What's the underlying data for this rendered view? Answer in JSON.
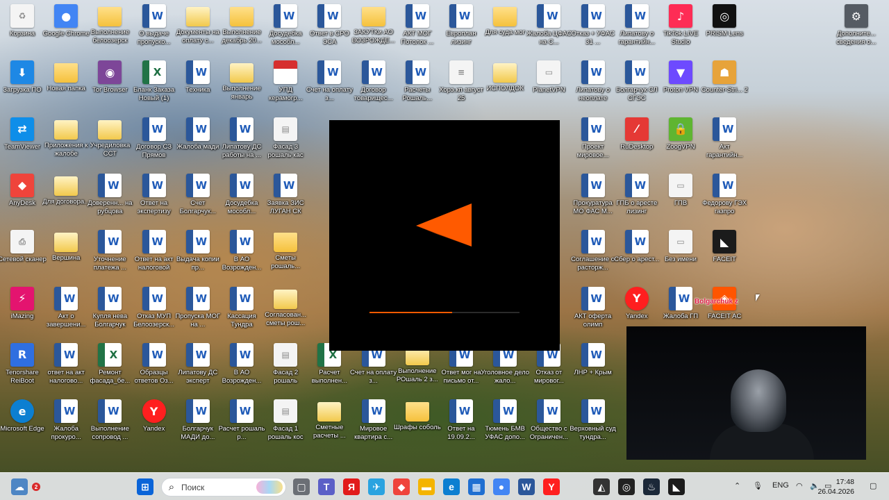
{
  "desktop": {
    "icons": [
      {
        "id": "c1r1",
        "label": "Корзина",
        "type": "white",
        "glyph": "♻"
      },
      {
        "id": "c2r1",
        "label": "Google Chrome",
        "type": "app",
        "glyph": "●",
        "color": "#4285f4"
      },
      {
        "id": "c3r1",
        "label": "Выполнение белоозерск",
        "type": "folder"
      },
      {
        "id": "c4r1",
        "label": "О выдаче пропуско...",
        "type": "word",
        "glyph": "W"
      },
      {
        "id": "c5r1",
        "label": "Документы на оплату с...",
        "type": "folder-doc"
      },
      {
        "id": "c6r1",
        "label": "Выполнение декабрь 20...",
        "type": "folder"
      },
      {
        "id": "c7r1",
        "label": "Досудебка мособл...",
        "type": "word",
        "glyph": "W"
      },
      {
        "id": "c8r1",
        "label": "Ответ в СРО ЭСА",
        "type": "word",
        "glyph": "W"
      },
      {
        "id": "c9r1",
        "label": "ЗАКУТКи АО ВОЗРОЖДЕ...",
        "type": "folder"
      },
      {
        "id": "c10r1",
        "label": "АКТ МОГ Потолок ...",
        "type": "word",
        "glyph": "W"
      },
      {
        "id": "c11r1",
        "label": "Европлан лизинг",
        "type": "word",
        "glyph": "W"
      },
      {
        "id": "c12r1",
        "label": "Для суда мог",
        "type": "folder"
      },
      {
        "id": "c13r1",
        "label": "Жалоба ЦФАС на С...",
        "type": "word",
        "glyph": "W"
      },
      {
        "id": "c14r1",
        "label": "Отказ + УФАС 31 ...",
        "type": "word",
        "glyph": "W"
      },
      {
        "id": "c15r1",
        "label": "Липатову о гарантийн...",
        "type": "word",
        "glyph": "W"
      },
      {
        "id": "c16r1",
        "label": "TikTok LIVE Studio",
        "type": "app",
        "glyph": "♪",
        "color": "#fe2c55"
      },
      {
        "id": "c17r1",
        "label": "PRISM Lens",
        "type": "app",
        "glyph": "◎",
        "color": "#111111"
      },
      {
        "id": "c20r1",
        "label": "Дополните... сведения о...",
        "type": "app",
        "glyph": "⚙",
        "color": "#555b63"
      },
      {
        "id": "c1r2",
        "label": "Загрузка ПО",
        "type": "app",
        "glyph": "⬇",
        "color": "#1e88e5"
      },
      {
        "id": "c2r2",
        "label": "Новая папка",
        "type": "folder"
      },
      {
        "id": "c3r2",
        "label": "Tor Browser",
        "type": "app",
        "glyph": "◉",
        "color": "#7d4698"
      },
      {
        "id": "c4r2",
        "label": "Бланк Заказа Новый (1)",
        "type": "excel",
        "glyph": "X"
      },
      {
        "id": "c5r2",
        "label": "Техника",
        "type": "word",
        "glyph": "W"
      },
      {
        "id": "c6r2",
        "label": "Выполнение январь",
        "type": "folder-doc"
      },
      {
        "id": "c7r2",
        "label": "УПД керамогр...",
        "type": "pdf",
        "glyph": "PDF"
      },
      {
        "id": "c8r2",
        "label": "Счет на оплату з...",
        "type": "word",
        "glyph": "W"
      },
      {
        "id": "c9r2",
        "label": "Договор товарищес...",
        "type": "word",
        "glyph": "W"
      },
      {
        "id": "c10r2",
        "label": "Расчеты Рошаль...",
        "type": "word",
        "glyph": "W"
      },
      {
        "id": "c11r2",
        "label": "Хорэ.кп август 25",
        "type": "white",
        "glyph": "≡"
      },
      {
        "id": "c12r2",
        "label": "ИСПОЛДОК",
        "type": "folder-doc"
      },
      {
        "id": "c13r2",
        "label": "PlanetVPN",
        "type": "white",
        "glyph": "▭"
      },
      {
        "id": "c14r2",
        "label": "Липатову о неоплате",
        "type": "word",
        "glyph": "W"
      },
      {
        "id": "c15r2",
        "label": "Болгарчук СЛ СГЭС",
        "type": "word",
        "glyph": "W"
      },
      {
        "id": "c16r2",
        "label": "Proton VPN",
        "type": "app",
        "glyph": "▼",
        "color": "#6d4aff"
      },
      {
        "id": "c17r2",
        "label": "Counter-Stri... 2",
        "type": "app",
        "glyph": "☗",
        "color": "#e7a33a"
      },
      {
        "id": "c1r3",
        "label": "TeamViewer",
        "type": "app",
        "glyph": "⇄",
        "color": "#0e8ee9"
      },
      {
        "id": "c2r3",
        "label": "Приложения к жалобе",
        "type": "folder-doc"
      },
      {
        "id": "c3r3",
        "label": "Учредиловка ССТ",
        "type": "folder-doc"
      },
      {
        "id": "c4r3",
        "label": "Договор СЗ Прямов",
        "type": "word",
        "glyph": "W"
      },
      {
        "id": "c5r3",
        "label": "Жалоба мади",
        "type": "word",
        "glyph": "W"
      },
      {
        "id": "c6r3",
        "label": "Липатову ДС работы на ...",
        "type": "word",
        "glyph": "W"
      },
      {
        "id": "c7r3",
        "label": "Фасад 3 рошаль кас",
        "type": "white",
        "glyph": "▤"
      },
      {
        "id": "c14r3",
        "label": "Проект мировое...",
        "type": "word",
        "glyph": "W"
      },
      {
        "id": "c15r3",
        "label": "RuDesktop",
        "type": "app",
        "glyph": "⁄",
        "color": "#e53935"
      },
      {
        "id": "c16r3",
        "label": "ZoogVPN",
        "type": "app",
        "glyph": "🔒",
        "color": "#5fb531"
      },
      {
        "id": "c17r3",
        "label": "Акт гарантийн...",
        "type": "word",
        "glyph": "W"
      },
      {
        "id": "c1r4",
        "label": "AnyDesk",
        "type": "app",
        "glyph": "◆",
        "color": "#ef443b"
      },
      {
        "id": "c2r4",
        "label": "Для договора...",
        "type": "folder-doc"
      },
      {
        "id": "c3r4",
        "label": "Доверенн... на рубцова",
        "type": "word",
        "glyph": "W"
      },
      {
        "id": "c4r4",
        "label": "Ответ на экспертизу",
        "type": "word",
        "glyph": "W"
      },
      {
        "id": "c5r4",
        "label": "Счет Болгарчук...",
        "type": "word",
        "glyph": "W"
      },
      {
        "id": "c6r4",
        "label": "Досудебка мособл...",
        "type": "word",
        "glyph": "W"
      },
      {
        "id": "c7r4",
        "label": "Заявка ЗИС ЛУГАН СК",
        "type": "word",
        "glyph": "W"
      },
      {
        "id": "c14r4",
        "label": "Прокуратура МО ФАС М...",
        "type": "word",
        "glyph": "W"
      },
      {
        "id": "c15r4",
        "label": "ГПБ о аресте лизинг",
        "type": "word",
        "glyph": "W"
      },
      {
        "id": "c16r4",
        "label": "ГПВ",
        "type": "white",
        "glyph": "▭"
      },
      {
        "id": "c17r4",
        "label": "Федорову ГЭХ газпро",
        "type": "word",
        "glyph": "W"
      },
      {
        "id": "c1r5",
        "label": "Сетевой сканер",
        "type": "white",
        "glyph": "⎙"
      },
      {
        "id": "c2r5",
        "label": "Вершина",
        "type": "folder-doc"
      },
      {
        "id": "c3r5",
        "label": "Уточнение платежа ...",
        "type": "word",
        "glyph": "W"
      },
      {
        "id": "c4r5",
        "label": "Ответ на акт налоговой",
        "type": "word",
        "glyph": "W"
      },
      {
        "id": "c5r5",
        "label": "Выдача копии пр...",
        "type": "word",
        "glyph": "W"
      },
      {
        "id": "c6r5",
        "label": "В АО Возрожден...",
        "type": "word",
        "glyph": "W"
      },
      {
        "id": "c7r5",
        "label": "Сметы рошаль...",
        "type": "folder"
      },
      {
        "id": "c14r5",
        "label": "Соглашение о расторж...",
        "type": "word",
        "glyph": "W"
      },
      {
        "id": "c15r5",
        "label": "Сбер о арест...",
        "type": "word",
        "glyph": "W"
      },
      {
        "id": "c16r5",
        "label": "Без имени",
        "type": "white",
        "glyph": "▭"
      },
      {
        "id": "c17r5",
        "label": "FACEIT",
        "type": "app",
        "glyph": "◣",
        "color": "#1b1b1b"
      },
      {
        "id": "c1r6",
        "label": "iMazing",
        "type": "app",
        "glyph": "⚡",
        "color": "#e4146f"
      },
      {
        "id": "c2r6",
        "label": "Акт о завершени...",
        "type": "word",
        "glyph": "W"
      },
      {
        "id": "c3r6",
        "label": "Купля нева Болгарчук",
        "type": "word",
        "glyph": "W"
      },
      {
        "id": "c4r6",
        "label": "Отказ МУП Белоозерск...",
        "type": "word",
        "glyph": "W"
      },
      {
        "id": "c5r6",
        "label": "Пропуска МОГ на ...",
        "type": "word",
        "glyph": "W"
      },
      {
        "id": "c6r6",
        "label": "Кассация Тундра",
        "type": "word",
        "glyph": "W"
      },
      {
        "id": "c7r6",
        "label": "Согласован... сметы рош...",
        "type": "folder-doc"
      },
      {
        "id": "c14r6",
        "label": "АКТ оферта олимп",
        "type": "word",
        "glyph": "W"
      },
      {
        "id": "c15r6",
        "label": "Yandex",
        "type": "app round",
        "glyph": "Y",
        "color": "#ff1f1f"
      },
      {
        "id": "c16r6",
        "label": "Жалоба ГП",
        "type": "word",
        "glyph": "W"
      },
      {
        "id": "c17r6",
        "label": "FACEIT AC",
        "type": "app",
        "glyph": "◈",
        "color": "#ff5500"
      },
      {
        "id": "c1r7",
        "label": "Tenorshare ReiBoot",
        "type": "app",
        "glyph": "R",
        "color": "#2f6fe0"
      },
      {
        "id": "c2r7",
        "label": "ответ на акт налогово...",
        "type": "word",
        "glyph": "W"
      },
      {
        "id": "c3r7",
        "label": "Ремонт фасада_бе...",
        "type": "excel",
        "glyph": "X"
      },
      {
        "id": "c4r7",
        "label": "Образцы ответов Оз...",
        "type": "word",
        "glyph": "W"
      },
      {
        "id": "c5r7",
        "label": "Липатову ДС эксперт",
        "type": "word",
        "glyph": "W"
      },
      {
        "id": "c6r7",
        "label": "В АО Возрожден...",
        "type": "word",
        "glyph": "W"
      },
      {
        "id": "c7r7",
        "label": "Фасад 2 рошаль",
        "type": "white",
        "glyph": "▤"
      },
      {
        "id": "c8r7",
        "label": "Расчет выполнен...",
        "type": "excel",
        "glyph": "X"
      },
      {
        "id": "c9r7",
        "label": "Счет на оплату з...",
        "type": "word",
        "glyph": "W"
      },
      {
        "id": "c10r7",
        "label": "Выполнение РОшаль 2 з...",
        "type": "folder-doc"
      },
      {
        "id": "c11r7",
        "label": "Ответ мог на письмо от...",
        "type": "word",
        "glyph": "W"
      },
      {
        "id": "c12r7",
        "label": "Уголовное дело жало...",
        "type": "word",
        "glyph": "W"
      },
      {
        "id": "c13r7",
        "label": "Отказ от мировог...",
        "type": "word",
        "glyph": "W"
      },
      {
        "id": "c14r7",
        "label": "ЛНР + Крым",
        "type": "word",
        "glyph": "W"
      },
      {
        "id": "c1r8",
        "label": "Microsoft Edge",
        "type": "app round",
        "glyph": "e",
        "color": "#0c7fd1"
      },
      {
        "id": "c2r8",
        "label": "Жалоба прокуро...",
        "type": "word",
        "glyph": "W"
      },
      {
        "id": "c3r8",
        "label": "Выполнение сопровод ...",
        "type": "word",
        "glyph": "W"
      },
      {
        "id": "c4r8",
        "label": "Yandex",
        "type": "app round",
        "glyph": "Y",
        "color": "#ff1f1f"
      },
      {
        "id": "c5r8",
        "label": "Болгарчук МАДИ до...",
        "type": "word",
        "glyph": "W"
      },
      {
        "id": "c6r8",
        "label": "Расчет рошаль р...",
        "type": "word",
        "glyph": "W"
      },
      {
        "id": "c7r8",
        "label": "Фасад 1 рошаль кос",
        "type": "white",
        "glyph": "▤"
      },
      {
        "id": "c8r8",
        "label": "Сметные расчеты ...",
        "type": "folder-doc"
      },
      {
        "id": "c9r8",
        "label": "Мировое квартира с...",
        "type": "word",
        "glyph": "W"
      },
      {
        "id": "c10r8",
        "label": "Шрафы соболь",
        "type": "folder"
      },
      {
        "id": "c11r8",
        "label": "Ответ на 19.09.2...",
        "type": "word",
        "glyph": "W"
      },
      {
        "id": "c12r8",
        "label": "Тюмень БМВ УФАС допо...",
        "type": "word",
        "glyph": "W"
      },
      {
        "id": "c13r8",
        "label": "Общество с Ограничен...",
        "type": "word",
        "glyph": "W"
      },
      {
        "id": "c14r8",
        "label": "Верховный суд тундра...",
        "type": "word",
        "glyph": "W"
      }
    ]
  },
  "loader": {
    "progress_fraction": 0.55,
    "accent": "#ff5a00"
  },
  "overlay": {
    "name_tag": "Bolgarchuk z"
  },
  "taskbar": {
    "notification_count": "2",
    "search_placeholder": "Поиск",
    "language": "ENG",
    "time": "17:48",
    "date": "26.04.2026",
    "apps": [
      {
        "name": "start",
        "glyph": "⊞",
        "color": "#0a64d8"
      },
      {
        "name": "task-view",
        "glyph": "▢",
        "color": "#6b6f75"
      },
      {
        "name": "teams",
        "glyph": "T",
        "color": "#5b5fc7"
      },
      {
        "name": "yandex",
        "glyph": "Я",
        "color": "#e21b1b"
      },
      {
        "name": "telegram-like",
        "glyph": "✈",
        "color": "#2aa3e0"
      },
      {
        "name": "anydesk",
        "glyph": "◆",
        "color": "#ef443b"
      },
      {
        "name": "explorer",
        "glyph": "▬",
        "color": "#f4b400"
      },
      {
        "name": "edge",
        "glyph": "e",
        "color": "#0c7fd1"
      },
      {
        "name": "store",
        "glyph": "▦",
        "color": "#1f6fd1"
      },
      {
        "name": "chrome",
        "glyph": "●",
        "color": "#4285f4"
      },
      {
        "name": "word",
        "glyph": "W",
        "color": "#2b579a"
      },
      {
        "name": "yandex-browser",
        "glyph": "Y",
        "color": "#ff1f1f"
      },
      {
        "name": "app-red",
        "glyph": "◭",
        "color": "#333333"
      },
      {
        "name": "obs",
        "glyph": "◎",
        "color": "#222222"
      },
      {
        "name": "steam",
        "glyph": "♨",
        "color": "#1b2838"
      },
      {
        "name": "faceit",
        "glyph": "◣",
        "color": "#1b1b1b"
      }
    ]
  }
}
